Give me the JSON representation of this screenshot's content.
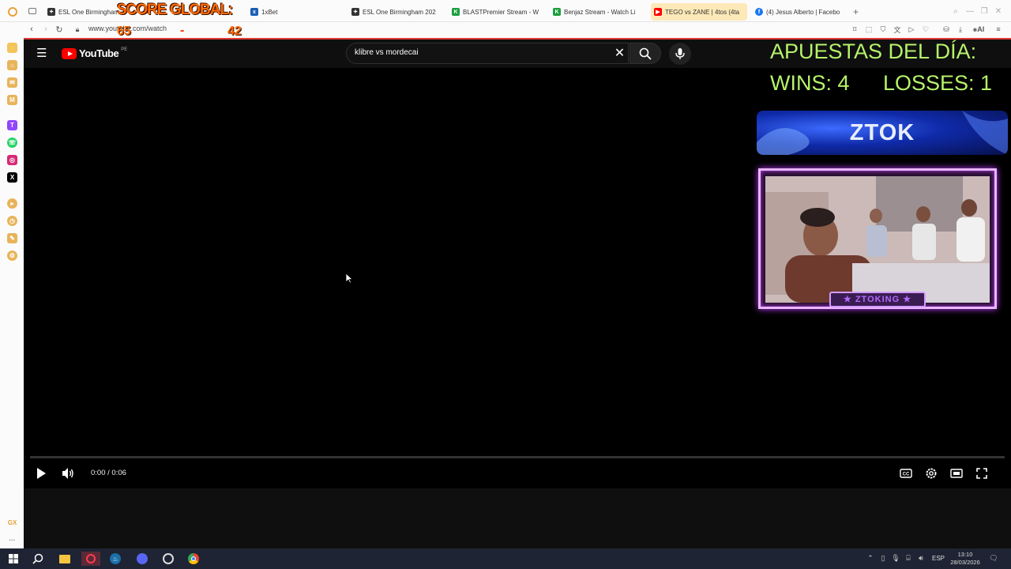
{
  "browser": {
    "tabs": [
      {
        "label": "ESL One Birmingham",
        "icon": "esl-icon"
      },
      {
        "label": "1xBet",
        "icon": "1xbet-icon"
      },
      {
        "label": "ESL One Birmingham 202",
        "icon": "esl-icon"
      },
      {
        "label": "BLASTPremier Stream - W",
        "icon": "kick-icon"
      },
      {
        "label": "Benjaz Stream - Watch Li",
        "icon": "kick-icon"
      },
      {
        "label": "TEGO vs ZANE | 4tos (4ta",
        "icon": "youtube-icon",
        "active": true
      },
      {
        "label": "(4) Jesus Alberto | Facebo",
        "icon": "facebook-icon"
      }
    ],
    "url": "www.youtube.com/watch",
    "accent": "#fde9b8"
  },
  "youtube": {
    "logo_text": "YouTube",
    "region": "PE",
    "search_value": "klibre vs mordecai",
    "player": {
      "time": "0:00 / 0:06",
      "progress": 0
    }
  },
  "overlay": {
    "score_title": "SCORE GLOBAL:",
    "score_a": "65",
    "score_dash": "-",
    "score_b": "42",
    "bets_title": "APUESTAS DEL DÍA:",
    "wins": "WINS: 4",
    "losses": "LOSSES: 1",
    "banner": "ZTOK",
    "webcam_label": "★ ZTOKING ★"
  },
  "taskbar": {
    "lang": "ESP",
    "time": "13:10",
    "date": "28/03/2026"
  }
}
